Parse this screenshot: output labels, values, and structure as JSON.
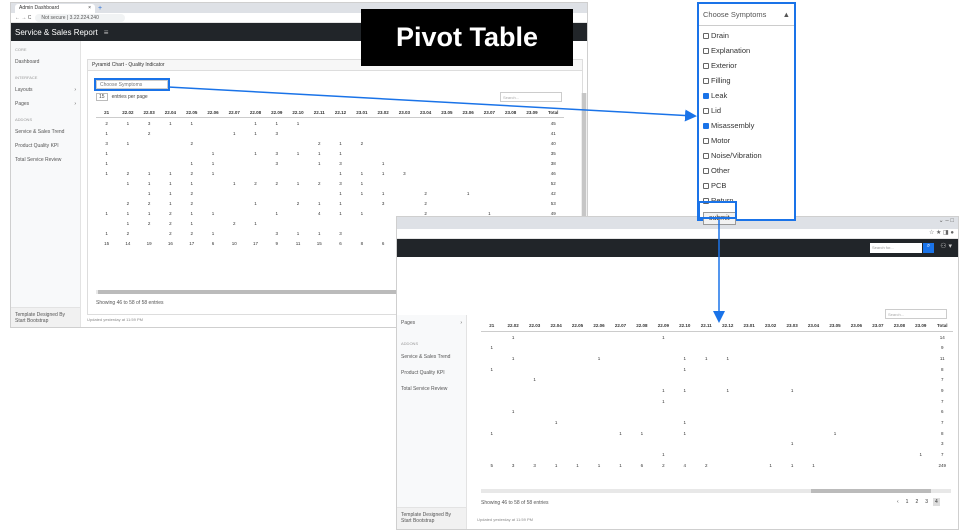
{
  "window1": {
    "tab_title": "Admin Dashboard",
    "tab_close": "×",
    "new_tab": "+",
    "nav_buttons": "← → C",
    "security": "Not secure",
    "address": "3.22.224.240",
    "app_title": "Service & Sales Report",
    "menu_icon": "≡",
    "sidebar": {
      "core_heading": "CORE",
      "dashboard": "Dashboard",
      "interface_heading": "INTERFACE",
      "layouts": "Layouts",
      "pages": "Pages",
      "addons_heading": "ADDONS",
      "service_sales_trend": "Service & Sales Trend",
      "product_quality_kpi": "Product Quality KPI",
      "total_service_review": "Total Service Review",
      "chevron": "›",
      "footer_line1": "Template Designed By",
      "footer_line2": "Start Bootstrap"
    },
    "card_title": "Pyramid Chart - Quality Indicator",
    "choose_placeholder": "Choose Symptoms",
    "entries_value": "15",
    "entries_label": "entries per page",
    "search_placeholder": "Search...",
    "columns": [
      "21",
      "22.02",
      "22.03",
      "22.04",
      "22.05",
      "22.06",
      "22.07",
      "22.08",
      "22.09",
      "22.10",
      "22.11",
      "22.12",
      "23.01",
      "23.02",
      "23.03",
      "23.04",
      "23.05",
      "23.06",
      "23.07",
      "23.08",
      "23.09",
      "Total"
    ],
    "rows": [
      [
        "2",
        "1",
        "3",
        "1",
        "1",
        "",
        "",
        "1",
        "1",
        "1",
        "",
        "",
        "",
        "",
        "",
        "",
        "",
        "",
        "",
        "",
        "",
        "45"
      ],
      [
        "1",
        "",
        "2",
        "",
        "",
        "",
        "1",
        "1",
        "3",
        "",
        "",
        "",
        "",
        "",
        "",
        "",
        "",
        "",
        "",
        "",
        "",
        "41"
      ],
      [
        "3",
        "1",
        "",
        "",
        "2",
        "",
        "",
        "",
        "",
        "",
        "2",
        "1",
        "2",
        "",
        "",
        "",
        "",
        "",
        "",
        "",
        "",
        "40"
      ],
      [
        "1",
        "",
        "",
        "",
        "",
        "1",
        "",
        "1",
        "3",
        "1",
        "1",
        "1",
        "",
        "",
        "",
        "",
        "",
        "",
        "",
        "",
        "",
        "35"
      ],
      [
        "1",
        "",
        "",
        "",
        "1",
        "1",
        "",
        "",
        "3",
        "",
        "1",
        "3",
        "",
        "1",
        "",
        "",
        "",
        "",
        "",
        "",
        "",
        "38"
      ],
      [
        "1",
        "2",
        "1",
        "1",
        "2",
        "1",
        "",
        "",
        "",
        "",
        "",
        "1",
        "1",
        "1",
        "3",
        "",
        "",
        "",
        "",
        "",
        "",
        "46"
      ],
      [
        "",
        "1",
        "1",
        "1",
        "1",
        "",
        "1",
        "2",
        "2",
        "1",
        "2",
        "3",
        "1",
        "",
        "",
        "",
        "",
        "",
        "",
        "",
        "",
        "52"
      ],
      [
        "",
        "",
        "1",
        "1",
        "2",
        "",
        "",
        "",
        "",
        "",
        "",
        "1",
        "1",
        "1",
        "",
        "2",
        "",
        "1",
        "",
        "",
        "",
        "42"
      ],
      [
        "",
        "2",
        "2",
        "1",
        "2",
        "",
        "",
        "1",
        "",
        "2",
        "1",
        "1",
        "",
        "3",
        "",
        "2",
        "",
        "",
        "",
        "",
        "",
        "53"
      ],
      [
        "1",
        "1",
        "1",
        "2",
        "1",
        "1",
        "",
        "",
        "1",
        "",
        "4",
        "1",
        "1",
        "",
        "",
        "2",
        "",
        "",
        "1",
        "",
        "",
        "49"
      ],
      [
        "",
        "1",
        "2",
        "2",
        "1",
        "",
        "2",
        "1",
        "",
        "",
        "",
        "",
        "",
        "",
        "",
        "2",
        "1",
        "2",
        "1",
        "",
        "",
        "49"
      ],
      [
        "1",
        "2",
        "",
        "2",
        "2",
        "1",
        "",
        "",
        "3",
        "1",
        "1",
        "3",
        "",
        "",
        "1",
        "",
        "",
        "1",
        "2",
        "",
        "",
        "48"
      ],
      [
        "15",
        "14",
        "19",
        "16",
        "17",
        "6",
        "10",
        "17",
        "9",
        "11",
        "15",
        "6",
        "8",
        "6",
        "5",
        "3",
        "1",
        "4",
        "",
        "",
        "",
        "1498"
      ]
    ],
    "showing": "Showing 46 to 58 of 58 entries",
    "pages": [
      "‹",
      "1",
      "2",
      "3",
      "4"
    ],
    "updated": "Updated yesterday at 11:59 PM"
  },
  "title_banner": "Pivot Table",
  "dropdown": {
    "header": "Choose Symptoms",
    "caret": "▲",
    "options": [
      {
        "label": "Drain",
        "checked": false
      },
      {
        "label": "Explanation",
        "checked": false
      },
      {
        "label": "Exterior",
        "checked": false
      },
      {
        "label": "Filling",
        "checked": false
      },
      {
        "label": "Leak",
        "checked": true
      },
      {
        "label": "Lid",
        "checked": false
      },
      {
        "label": "Misassembly",
        "checked": true
      },
      {
        "label": "Motor",
        "checked": false
      },
      {
        "label": "Noise/Vibration",
        "checked": false
      },
      {
        "label": "Other",
        "checked": false
      },
      {
        "label": "PCB",
        "checked": false
      },
      {
        "label": "Return",
        "checked": false
      }
    ],
    "submit": "submit"
  },
  "window2": {
    "window_controls": "⌄ – □",
    "toolbar_icons": "☆ ★ ◨ ●",
    "search_placeholder": "Search for...",
    "search_icon": "⌕",
    "user_icon": "⚇ ▾",
    "sidebar": {
      "pages": "Pages",
      "addons_heading": "ADDONS",
      "service_sales_trend": "Service & Sales Trend",
      "product_quality_kpi": "Product Quality KPI",
      "total_service_review": "Total Service Review",
      "chevron": "›",
      "footer_line1": "Template Designed By",
      "footer_line2": "Start Bootstrap"
    },
    "search_placeholder2": "Search...",
    "columns": [
      "21",
      "22.02",
      "22.03",
      "22.04",
      "22.05",
      "22.06",
      "22.07",
      "22.08",
      "22.09",
      "22.10",
      "22.11",
      "22.12",
      "23.01",
      "23.02",
      "23.03",
      "23.04",
      "23.05",
      "23.06",
      "23.07",
      "23.08",
      "23.09",
      "Total"
    ],
    "rows": [
      [
        "",
        "1",
        "",
        "",
        "",
        "",
        "",
        "",
        "1",
        "",
        "",
        "",
        "",
        "",
        "",
        "",
        "",
        "",
        "",
        "",
        "",
        "14"
      ],
      [
        "1",
        "",
        "",
        "",
        "",
        "",
        "",
        "",
        "",
        "",
        "",
        "",
        "",
        "",
        "",
        "",
        "",
        "",
        "",
        "",
        "",
        "9"
      ],
      [
        "",
        "1",
        "",
        "",
        "",
        "1",
        "",
        "",
        "",
        "1",
        "1",
        "1",
        "",
        "",
        "",
        "",
        "",
        "",
        "",
        "",
        "",
        "11"
      ],
      [
        "1",
        "",
        "",
        "",
        "",
        "",
        "",
        "",
        "",
        "1",
        "",
        "",
        "",
        "",
        "",
        "",
        "",
        "",
        "",
        "",
        "",
        "8"
      ],
      [
        "",
        "",
        "1",
        "",
        "",
        "",
        "",
        "",
        "",
        "",
        "",
        "",
        "",
        "",
        "",
        "",
        "",
        "",
        "",
        "",
        "",
        "7"
      ],
      [
        "",
        "",
        "",
        "",
        "",
        "",
        "",
        "",
        "1",
        "1",
        "",
        "1",
        "",
        "",
        "1",
        "",
        "",
        "",
        "",
        "",
        "",
        "9"
      ],
      [
        "",
        "",
        "",
        "",
        "",
        "",
        "",
        "",
        "1",
        "",
        "",
        "",
        "",
        "",
        "",
        "",
        "",
        "",
        "",
        "",
        "",
        "7"
      ],
      [
        "",
        "1",
        "",
        "",
        "",
        "",
        "",
        "",
        "",
        "",
        "",
        "",
        "",
        "",
        "",
        "",
        "",
        "",
        "",
        "",
        "",
        "6"
      ],
      [
        "",
        "",
        "",
        "1",
        "",
        "",
        "",
        "",
        "",
        "1",
        "",
        "",
        "",
        "",
        "",
        "",
        "",
        "",
        "",
        "",
        "",
        "7"
      ],
      [
        "1",
        "",
        "",
        "",
        "",
        "",
        "1",
        "1",
        "",
        "1",
        "",
        "",
        "",
        "",
        "",
        "",
        "1",
        "",
        "",
        "",
        "",
        "8"
      ],
      [
        "",
        "",
        "",
        "",
        "",
        "",
        "",
        "",
        "",
        "",
        "",
        "",
        "",
        "",
        "1",
        "",
        "",
        "",
        "",
        "",
        "",
        "3"
      ],
      [
        "",
        "",
        "",
        "",
        "",
        "",
        "",
        "",
        "1",
        "",
        "",
        "",
        "",
        "",
        "",
        "",
        "",
        "",
        "",
        "",
        "1",
        "7"
      ],
      [
        "5",
        "3",
        "3",
        "1",
        "1",
        "1",
        "1",
        "6",
        "2",
        "4",
        "2",
        "",
        "",
        "1",
        "1",
        "1",
        "",
        "",
        "",
        "",
        "",
        "249"
      ]
    ],
    "showing": "Showing 46 to 58 of 58 entries",
    "pages": [
      "‹",
      "1",
      "2",
      "3",
      "4"
    ],
    "updated": "Updated yesterday at 11:59 PM"
  },
  "colors": {
    "highlight": "#1a73e8",
    "navbar": "#212529"
  }
}
